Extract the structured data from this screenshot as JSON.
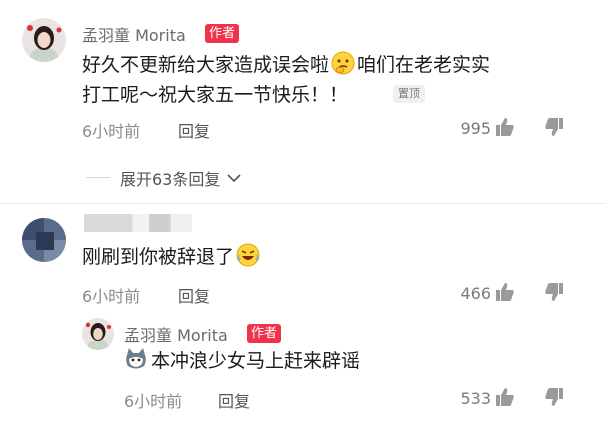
{
  "comments": [
    {
      "username": "孟羽童 Morita",
      "badge": "作者",
      "text_line1": "好久不更新给大家造成误会啦",
      "text_line1b": "咱们在老老实实",
      "text_line2": "打工呢～祝大家五一节快乐！！",
      "pinned_label": "置顶",
      "time": "6小时前",
      "reply_label": "回复",
      "likes": "995",
      "emoji": "thinking-face-icon"
    },
    {
      "username": "",
      "text": "刚刷到你被辞退了",
      "time": "6小时前",
      "reply_label": "回复",
      "likes": "466",
      "emoji": "rolling-laughing-face-icon"
    }
  ],
  "expand_replies": "展开63条回复",
  "replies": [
    {
      "username": "孟羽童 Morita",
      "badge": "作者",
      "text": "本冲浪少女马上赶来辟谣",
      "time": "6小时前",
      "reply_label": "回复",
      "likes": "533",
      "emoji": "cat-face-icon"
    }
  ],
  "colors": {
    "accent_badge": "#f0324a",
    "meta_gray": "#8c8c8c"
  }
}
